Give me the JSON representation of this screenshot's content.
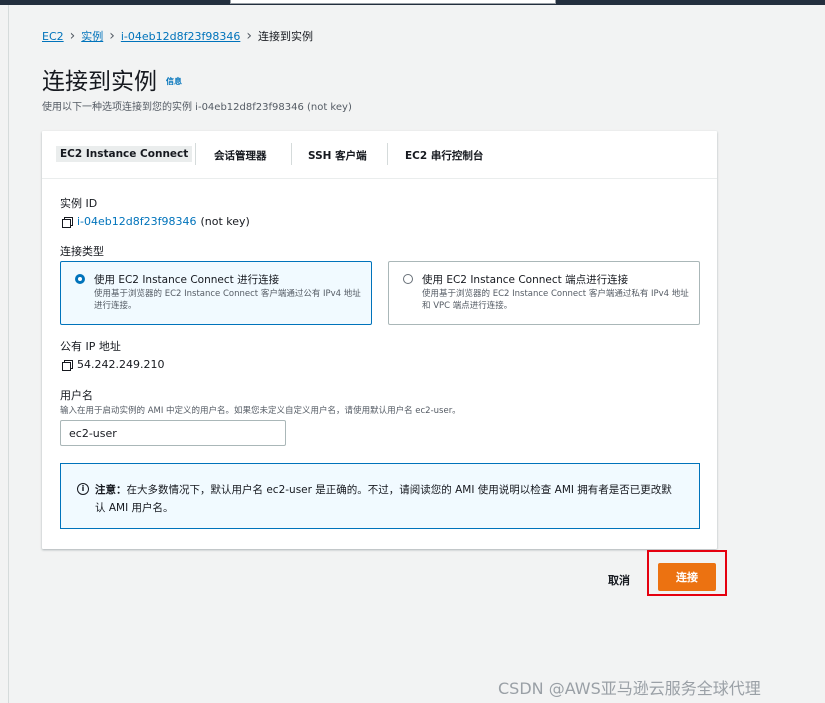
{
  "breadcrumb": [
    "EC2",
    "实例",
    "i-04eb12d8f23f98346",
    "连接到实例"
  ],
  "page": {
    "title": "连接到实例",
    "info": "信息",
    "subtitle": "使用以下一种选项连接到您的实例 i-04eb12d8f23f98346 (not key)"
  },
  "tabs": [
    {
      "label": "EC2 Instance Connect",
      "active": true
    },
    {
      "label": "会话管理器",
      "active": false
    },
    {
      "label": "SSH 客户端",
      "active": false
    },
    {
      "label": "EC2 串行控制台",
      "active": false
    }
  ],
  "instance": {
    "label": "实例 ID",
    "id": "i-04eb12d8f23f98346",
    "suffix": "(not key)"
  },
  "connection_type": {
    "label": "连接类型",
    "options": [
      {
        "title": "使用 EC2 Instance Connect 进行连接",
        "desc": "使用基于浏览器的 EC2 Instance Connect 客户端通过公有 IPv4 地址进行连接。",
        "selected": true
      },
      {
        "title": "使用 EC2 Instance Connect 端点进行连接",
        "desc": "使用基于浏览器的 EC2 Instance Connect 客户端通过私有 IPv4 地址和 VPC 端点进行连接。",
        "selected": false
      }
    ]
  },
  "public_ip": {
    "label": "公有 IP 地址",
    "value": "54.242.249.210"
  },
  "username": {
    "label": "用户名",
    "hint": "输入在用于启动实例的 AMI 中定义的用户名。如果您未定义自定义用户名，请使用默认用户名 ec2-user。",
    "value": "ec2-user"
  },
  "alert": {
    "icon": "info-icon",
    "strong": "注意：",
    "text": "在大多数情况下，默认用户名 ec2-user 是正确的。不过，请阅读您的 AMI 使用说明以检查 AMI 拥有者是否已更改默认 AMI 用户名。"
  },
  "actions": {
    "cancel": "取消",
    "connect": "连接"
  },
  "watermark": "CSDN @AWS亚马逊云服务全球代理",
  "colors": {
    "primary_button": "#ec7211",
    "link": "#0073bb",
    "highlight_box": "#e5000f"
  }
}
